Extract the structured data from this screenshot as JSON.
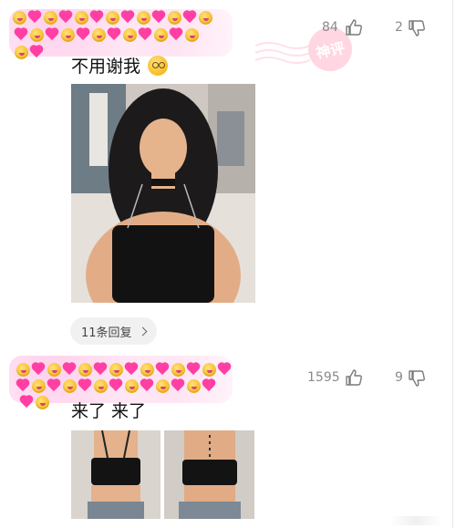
{
  "comments": [
    {
      "likes": "84",
      "dislikes": "2",
      "text": "不用谢我",
      "replies_label": "11条回复",
      "stamp_text": "神评"
    },
    {
      "likes": "1595",
      "dislikes": "9",
      "text": "来了 来了"
    }
  ],
  "icons": {
    "like": "thumbs-up-icon",
    "dislike": "thumbs-down-icon",
    "chevron": "chevron-right-icon"
  },
  "colors": {
    "emoji_heart": "#ff3fa4",
    "emoji_face": "#f6b81c",
    "stamp": "#ffd0dc",
    "count_text": "#8a8a8a"
  }
}
